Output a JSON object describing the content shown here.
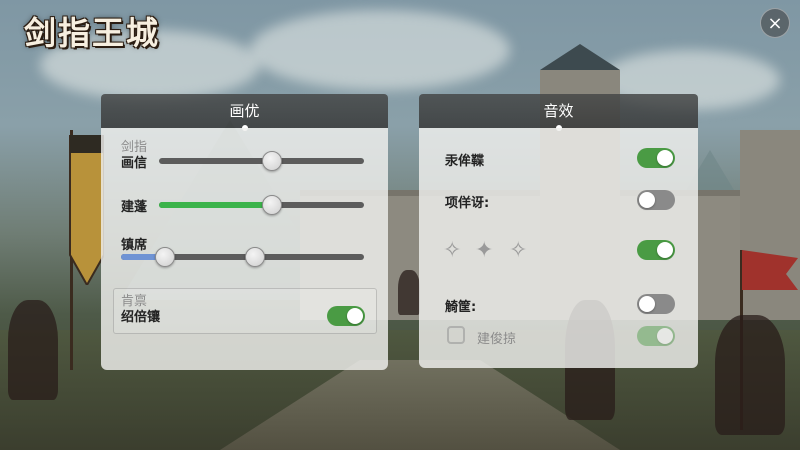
{
  "game": {
    "title": "剑指王城"
  },
  "close": {
    "icon": "×"
  },
  "graphics": {
    "header": "画优",
    "sliders": [
      {
        "label_top": "剑指",
        "label": "画信",
        "value": 0.55,
        "fill_color": ""
      },
      {
        "label": "建蓬",
        "value": 0.55,
        "fill_color": "#3bb34a"
      },
      {
        "label": "镇席",
        "value": 0.55,
        "low_value": 0.18,
        "fill_color": "#6f93d4"
      }
    ],
    "toggle_group": {
      "caption": "肯禀",
      "label": "绍倍镶",
      "on": true
    }
  },
  "audio": {
    "header": "音效",
    "rows": [
      {
        "label": "汞侔鞢",
        "on": true
      },
      {
        "label": "项佯讶:",
        "on": false
      },
      {
        "label": "",
        "stars": [
          "✧",
          "✦",
          "✧"
        ],
        "on": true
      },
      {
        "label": "觭筐:",
        "on": false
      },
      {
        "label": "建俊掠",
        "on": true,
        "disabled": true
      }
    ]
  },
  "colors": {
    "toggle_on": "#4a9b44",
    "toggle_off": "#8a8a8a"
  }
}
